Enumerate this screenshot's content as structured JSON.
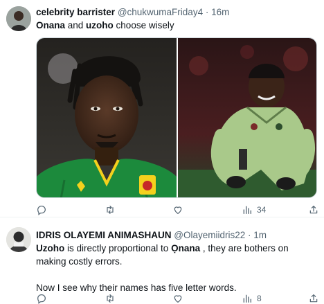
{
  "tweets": [
    {
      "author": {
        "name": "celebrity barrister",
        "handle": "@chukwumaFriday4",
        "time": "16m"
      },
      "text": {
        "part1": "Onana",
        "part2": " and ",
        "part3": "uzoho",
        "part4": " choose wisely"
      },
      "stats": {
        "views": "34"
      }
    },
    {
      "author": {
        "name": "IDRIS OLAYEMI ANIMASHAUN",
        "handle": "@Olayemiidris22",
        "time": "1m"
      },
      "text": {
        "part1": "Uzoho",
        "part2": " is directly proportional to ",
        "part3": "Ọnana",
        "part4": " , they are bothers on making costly errors.",
        "para2": "Now I see why their names has five letter words."
      },
      "stats": {
        "views": "8"
      }
    }
  ],
  "separator": "·",
  "icons": [
    "reply-icon",
    "retweet-icon",
    "like-icon",
    "views-icon",
    "share-icon"
  ],
  "colors": {
    "secondary_text": "#536471",
    "divider": "#eff3f4"
  }
}
